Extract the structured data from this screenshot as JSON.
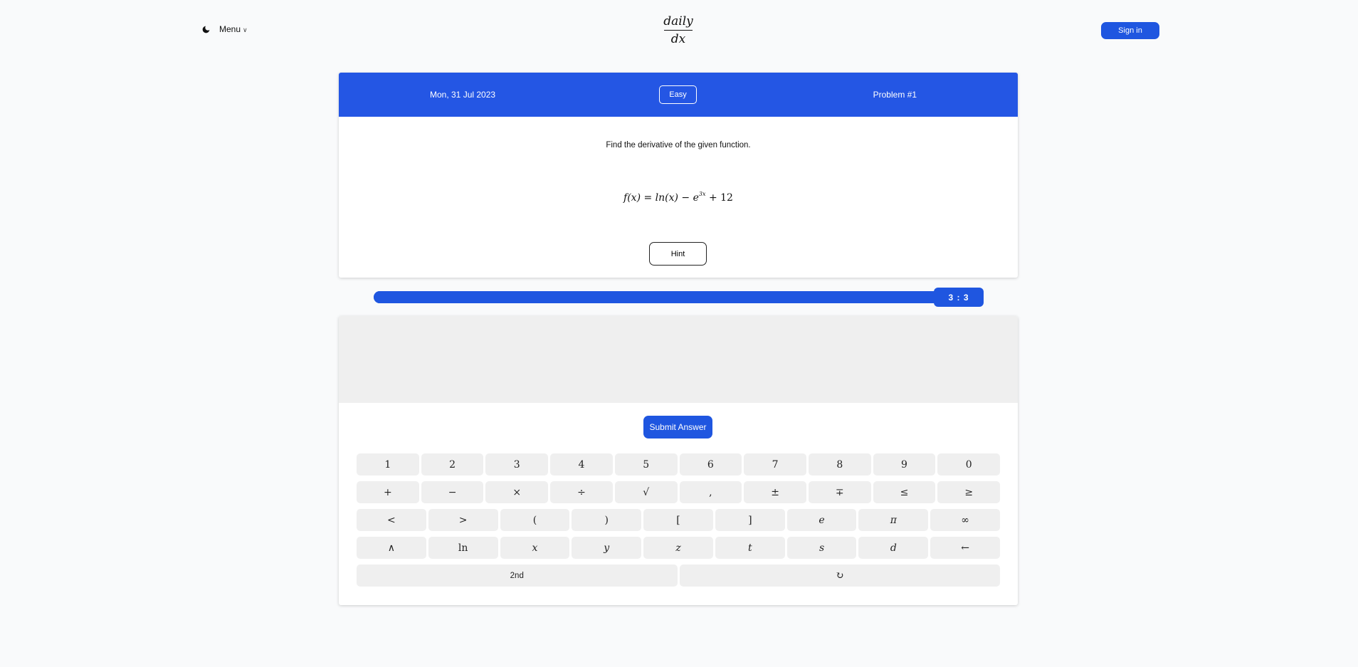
{
  "header": {
    "menu_label": "Menu",
    "logo_numerator": "daily",
    "logo_denominator": "dx",
    "signin_label": "Sign in"
  },
  "problem": {
    "date": "Mon, 31 Jul 2023",
    "difficulty": "Easy",
    "number_label": "Problem #1",
    "instruction": "Find the derivative of the given function.",
    "formula": {
      "lhs": "f(x) = ln(x) − e",
      "exponent": "3x",
      "rhs": " + 12"
    },
    "hint_label": "Hint"
  },
  "timer": {
    "label": "3 : 3",
    "progress_percent": 100
  },
  "answer": {
    "submit_label": "Submit Answer"
  },
  "keypad": {
    "row1": [
      "1",
      "2",
      "3",
      "4",
      "5",
      "6",
      "7",
      "8",
      "9",
      "0"
    ],
    "row2": [
      "+",
      "−",
      "×",
      "÷",
      "√",
      ",",
      "±",
      "∓",
      "≤",
      "≥"
    ],
    "row3": [
      "<",
      ">",
      "(",
      ")",
      "[",
      "]",
      "e",
      "π",
      "∞"
    ],
    "row4": [
      "∧",
      "ln",
      "x",
      "y",
      "z",
      "t",
      "s",
      "d",
      "←"
    ],
    "row5": [
      "2nd",
      "↻"
    ]
  },
  "colors": {
    "accent": "#1f56e0",
    "header_blue": "#2456e4",
    "key_bg": "#efefef"
  }
}
